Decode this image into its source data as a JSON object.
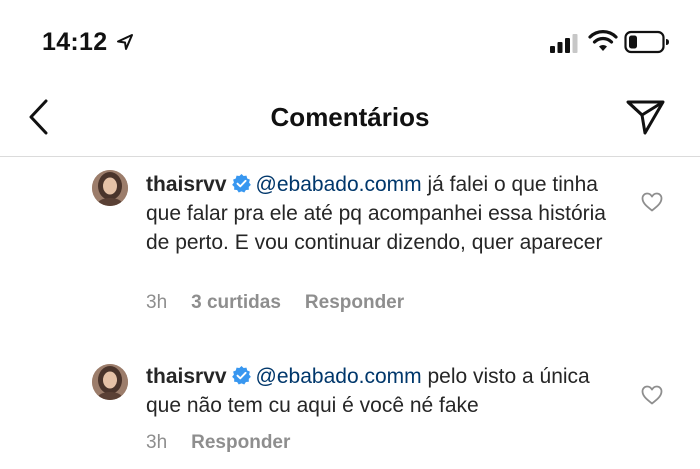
{
  "status_bar": {
    "time": "14:12",
    "icons": [
      "location-arrow-icon",
      "signal-bars-icon",
      "wifi-icon",
      "battery-icon"
    ]
  },
  "header": {
    "title": "Comentários",
    "icons": [
      "back-chevron-icon",
      "send-icon"
    ]
  },
  "comments": [
    {
      "username": "thaisrvv",
      "verified": true,
      "mention": "@ebabado.comm",
      "text": "já falei o que tinha que falar pra ele até pq acompanhei essa história de perto. E vou continuar dizendo, quer aparecer",
      "time": "3h",
      "likes": "3 curtidas",
      "reply_label": "Responder"
    },
    {
      "username": "thaisrvv",
      "verified": true,
      "mention": "@ebabado.comm",
      "text": "pelo visto a única que não tem cu aqui é você né fake",
      "time": "3h",
      "reply_label": "Responder"
    }
  ],
  "colors": {
    "mention": "#00376b",
    "verified_badge": "#3897f0",
    "meta_text": "#8e8e8e",
    "divider": "#dbdbdb"
  }
}
